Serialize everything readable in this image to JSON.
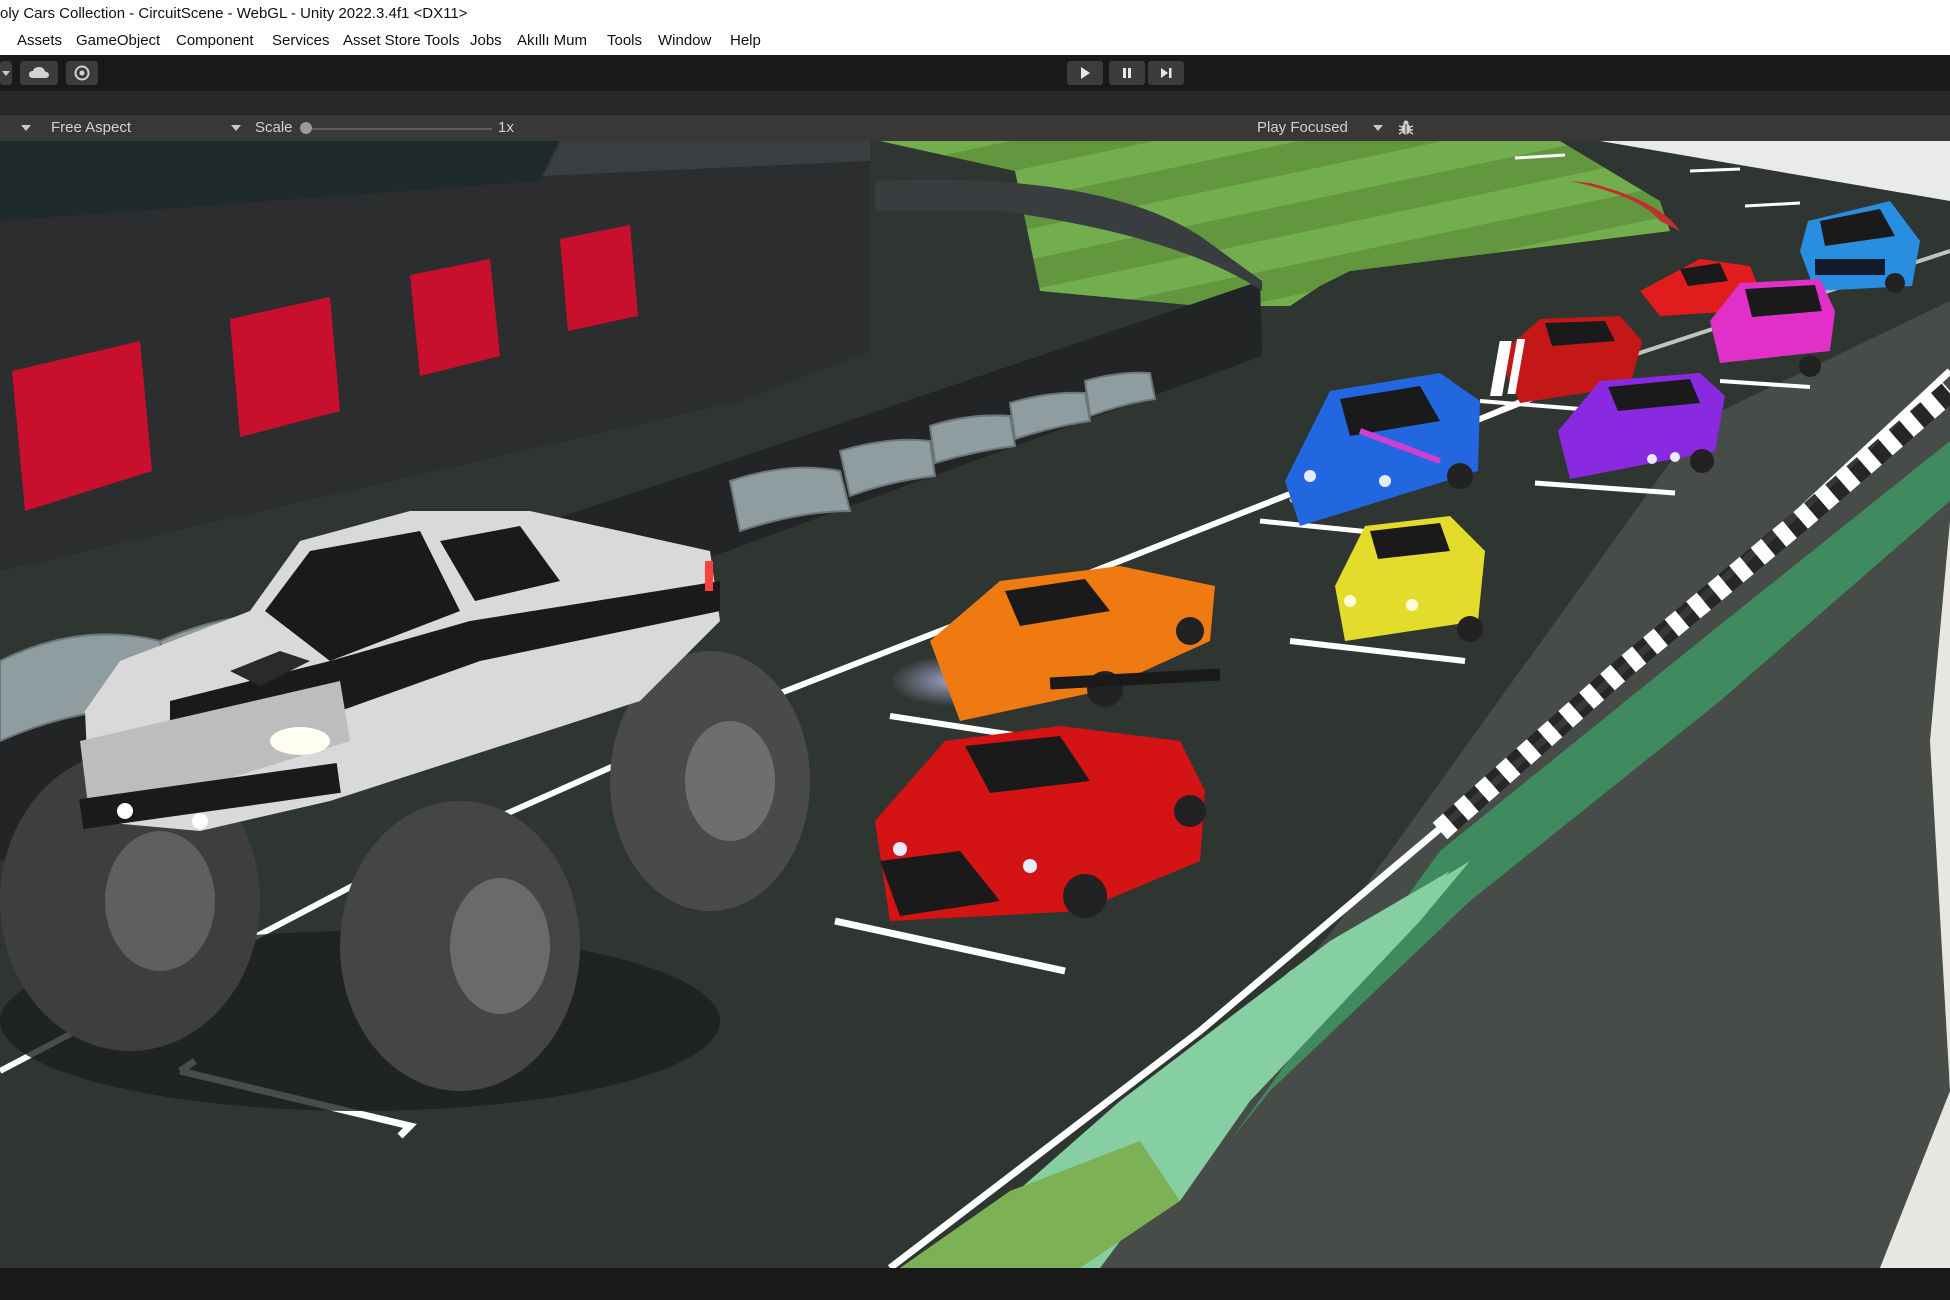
{
  "window": {
    "title": "oly Cars Collection - CircuitScene - WebGL - Unity 2022.3.4f1 <DX11>"
  },
  "menu": [
    "Assets",
    "GameObject",
    "Component",
    "Services",
    "Asset Store Tools",
    "Jobs",
    "Akıllı Mum",
    "Tools",
    "Window",
    "Help"
  ],
  "toolbar": {
    "cloud_icon": "cloud-icon",
    "collab_icon": "collab-icon",
    "play_icon": "play-icon",
    "pause_icon": "pause-icon",
    "step_icon": "step-icon"
  },
  "game_view": {
    "aspect_label": "Free Aspect",
    "scale_label": "Scale",
    "scale_value": "1x",
    "scale_level": 0,
    "play_mode_label": "Play Focused",
    "bug_icon": "bug-icon"
  },
  "scene": {
    "cars": [
      {
        "name": "monster-truck",
        "color": "#e0e0e0"
      },
      {
        "name": "red-sports-car",
        "color": "#d41414"
      },
      {
        "name": "orange-supercar",
        "color": "#f07a12"
      },
      {
        "name": "yellow-hatchback",
        "color": "#e3dc2a"
      },
      {
        "name": "blue-rally-car",
        "color": "#2266e0"
      },
      {
        "name": "purple-muscle-car",
        "color": "#8a2ae0"
      },
      {
        "name": "red-muscle-car",
        "color": "#c41818"
      },
      {
        "name": "pink-suv",
        "color": "#e030c8"
      },
      {
        "name": "red-hypercar",
        "color": "#e01c1c"
      },
      {
        "name": "blue-pickup",
        "color": "#2a8ee0"
      }
    ],
    "colors": {
      "asphalt": "#2f3631",
      "grass": "#6fa84a",
      "pit_wall": "#222426",
      "garage_door": "#c8102e"
    }
  }
}
